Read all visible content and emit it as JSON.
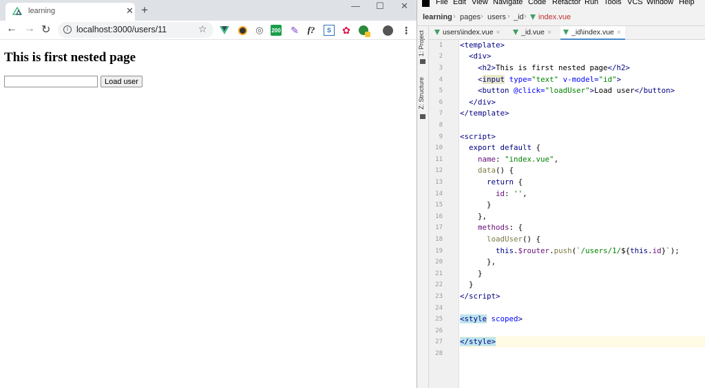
{
  "browser": {
    "tab_title": "learning",
    "url": "localhost:3000/users/11",
    "page": {
      "heading": "This is first nested page",
      "input_value": "",
      "button_label": "Load user"
    },
    "extensions": [
      "vue-devtools",
      "ext-dark",
      "ext-circle",
      "ext-200",
      "feather",
      "fx",
      "ext-chart",
      "ext-flower",
      "ext-badge"
    ],
    "ext_badge_200": "200",
    "ext_fx": "f?"
  },
  "ide": {
    "menu": [
      "File",
      "Edit",
      "View",
      "Navigate",
      "Code",
      "Refactor",
      "Run",
      "Tools",
      "VCS",
      "Window",
      "Help"
    ],
    "breadcrumbs": [
      "learning",
      "pages",
      "users",
      "_id",
      "index.vue"
    ],
    "side_tools": [
      "1: Project",
      "Z: Structure"
    ],
    "editor_tabs": [
      {
        "label": "users\\index.vue",
        "active": false
      },
      {
        "label": "_id.vue",
        "active": false
      },
      {
        "label": "_id\\index.vue",
        "active": true
      }
    ],
    "line_numbers": [
      "1",
      "2",
      "3",
      "4",
      "5",
      "6",
      "7",
      "8",
      "9",
      "10",
      "11",
      "12",
      "13",
      "14",
      "15",
      "16",
      "17",
      "18",
      "19",
      "20",
      "21",
      "22",
      "23",
      "24",
      "25",
      "26",
      "27",
      "28"
    ],
    "current_line": 27
  }
}
